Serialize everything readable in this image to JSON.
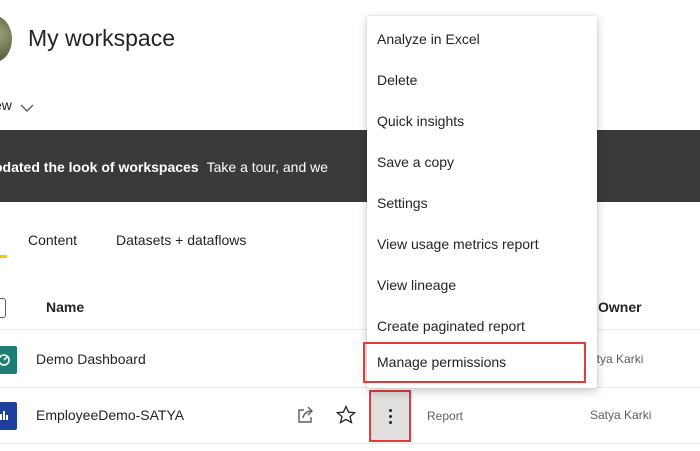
{
  "workspace": {
    "title": "My workspace"
  },
  "view_menu": {
    "label": "ew"
  },
  "banner": {
    "bold_text": "odated the look of workspaces",
    "text": "Take a tour, and we"
  },
  "tabs": [
    {
      "label": "Content"
    },
    {
      "label": "Datasets + dataflows"
    }
  ],
  "table": {
    "headers": {
      "name": "Name",
      "owner": "Owner"
    },
    "rows": [
      {
        "name": "Demo Dashboard",
        "type": "",
        "owner": "atya Karki"
      },
      {
        "name": "EmployeeDemo-SATYA",
        "type": "Report",
        "owner": "Satya Karki"
      }
    ]
  },
  "context_menu": {
    "items": [
      {
        "label": "Analyze in Excel"
      },
      {
        "label": "Delete"
      },
      {
        "label": "Quick insights"
      },
      {
        "label": "Save a copy"
      },
      {
        "label": "Settings"
      },
      {
        "label": "View usage metrics report"
      },
      {
        "label": "View lineage"
      },
      {
        "label": "Create paginated report"
      },
      {
        "label": "Manage permissions"
      }
    ]
  },
  "colors": {
    "banner_bg": "#3b3a39",
    "tab_accent": "#f2c811",
    "highlight_border": "#e13b3b",
    "dashboard_icon": "#1d7c74",
    "report_icon": "#1f3f9c"
  },
  "icons": [
    "avatar",
    "chevron-down-icon",
    "dashboard-icon",
    "report-icon",
    "share-icon",
    "star-icon",
    "more-options-icon"
  ]
}
